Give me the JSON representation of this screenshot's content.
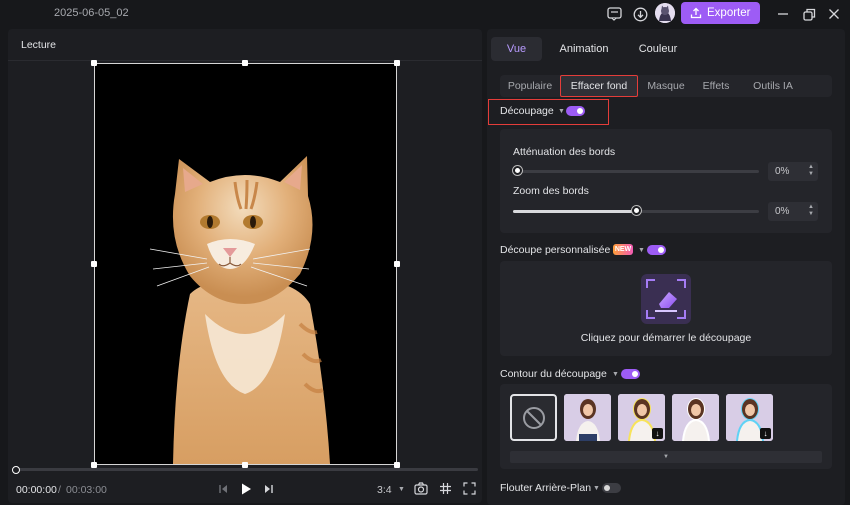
{
  "titlebar": {
    "project_title": "2025-06-05_02",
    "export_label": "Exporter",
    "icons": [
      "feedback-icon",
      "download-icon",
      "avatar",
      "export-icon",
      "minimize-icon",
      "restore-icon",
      "close-icon"
    ]
  },
  "player": {
    "title": "Lecture",
    "time_current": "00:00:00",
    "time_separator": "/",
    "time_total": "00:03:00",
    "playhead_progress": 0,
    "aspect_ratio": "3:4"
  },
  "inspector": {
    "tabs": [
      "Vue",
      "Animation",
      "Couleur"
    ],
    "active_tab": "Vue",
    "subtabs": [
      "Populaire",
      "Effacer fond",
      "Masque",
      "Effets",
      "Outils IA"
    ],
    "active_subtab": "Effacer fond",
    "decoupage": {
      "label": "Découpage",
      "enabled": true
    },
    "edge_softening": {
      "label": "Atténuation des bords",
      "value": "0%",
      "level": 0
    },
    "edge_zoom": {
      "label": "Zoom des bords",
      "value": "0%",
      "level": 0.5
    },
    "custom_cutout": {
      "label": "Découpe personnalisée",
      "badge": "NEW",
      "enabled": true,
      "start_text": "Cliquez pour démarrer le découpage"
    },
    "contour": {
      "label": "Contour du découpage",
      "enabled": true
    },
    "blur_background": {
      "label": "Flouter Arrière-Plan",
      "enabled": false
    }
  },
  "colors": {
    "accent": "#9d5cf5",
    "highlight_box": "#e43d3a",
    "panel": "#1d1e22",
    "background": "#17181b"
  }
}
